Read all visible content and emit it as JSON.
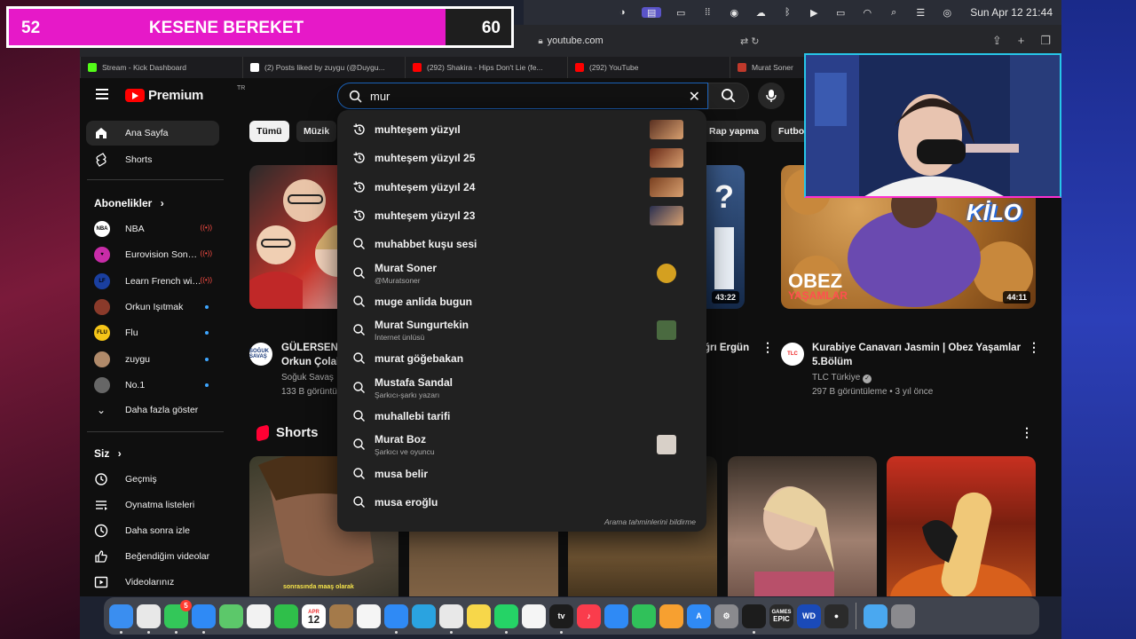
{
  "banner": {
    "left_number": "52",
    "title": "KESENE BEREKET",
    "right_number": "60",
    "progress_fraction": 0.87
  },
  "menubar": {
    "clock": "Sun Apr 12  21:44"
  },
  "browser": {
    "url": "youtube.com"
  },
  "tabs": [
    {
      "label": "Stream - Kick Dashboard",
      "color": "#53fc18"
    },
    {
      "label": "(2) Posts liked by zuygu (@Duygu...",
      "color": "#ffffff"
    },
    {
      "label": "(292) Shakira - Hips Don't Lie (fe...",
      "color": "#ff0000"
    },
    {
      "label": "(292) YouTube",
      "color": "#ff0000"
    },
    {
      "label": "Murat Soner",
      "color": "#c0392b"
    }
  ],
  "youtube": {
    "logo_text": "Premium",
    "logo_tr": "TR",
    "search_value": "mur",
    "report_text": "Arama tahminlerini bildirme"
  },
  "sidebar": {
    "home": "Ana Sayfa",
    "shorts": "Shorts",
    "subscriptions_header": "Abonelikler",
    "subscriptions": [
      {
        "label": "NBA",
        "live": true,
        "avatar_text": "NBA",
        "color": "#ffffff"
      },
      {
        "label": "Eurovision Song ...",
        "live": true,
        "avatar_text": "♥",
        "color": "#c82ca8"
      },
      {
        "label": "Learn French wit...",
        "live": true,
        "avatar_text": "LF",
        "color": "#1a3fa0"
      },
      {
        "label": "Orkun Işıtmak",
        "live": false,
        "avatar_text": "",
        "color": "#8a3a2a"
      },
      {
        "label": "Flu",
        "live": false,
        "avatar_text": "FLU",
        "color": "#f5c518"
      },
      {
        "label": "zuygu",
        "live": false,
        "avatar_text": "",
        "color": "#b08a6a"
      },
      {
        "label": "No.1",
        "live": false,
        "avatar_text": "",
        "color": "#666666"
      }
    ],
    "show_more": "Daha fazla göster",
    "you_header": "Siz",
    "you_items": [
      "Geçmiş",
      "Oynatma listeleri",
      "Daha sonra izle",
      "Beğendiğim videolar",
      "Videolarınız"
    ]
  },
  "chips": [
    "Tümü",
    "Müzik",
    "Rap yapma",
    "Futbol"
  ],
  "videos": [
    {
      "title_line1": "GÜLERSEN K",
      "title_line2": "Orkun Çolak",
      "channel": "Soğuk Savaş",
      "views": "133 B görüntü",
      "avatar_text": "SOĞUK SAVAŞ"
    },
    {
      "duration": "43:22",
      "title_line1": "ğrı Ergün"
    },
    {
      "duration": "44:11",
      "title_line1": "Kurabiye Canavarı Jasmin | Obez Yaşamlar",
      "title_line2": "5.Bölüm",
      "channel": "TLC Türkiye",
      "views": "297 B görüntüleme • 3 yıl önce",
      "avatar_text": "TLC",
      "overlay_top": "KİLO",
      "overlay_bottom_1": "OBEZ",
      "overlay_bottom_2": "YAŞAMLAR"
    }
  ],
  "shorts_section": {
    "title": "Shorts",
    "caption_1": "sonrasında maaş olarak"
  },
  "suggestions": [
    {
      "text": "muhteşem yüzyıl",
      "history": true,
      "thumb": "#5a3020"
    },
    {
      "text": "muhteşem yüzyıl 25",
      "history": true,
      "thumb": "#6a2a18"
    },
    {
      "text": "muhteşem yüzyıl 24",
      "history": true,
      "thumb": "#7a4020"
    },
    {
      "text": "muhteşem yüzyıl 23",
      "history": true,
      "thumb": "#2a3050"
    },
    {
      "text": "muhabbet kuşu sesi"
    },
    {
      "text": "Murat Soner",
      "sub": "@Muratsoner",
      "avatar": "#d4a020"
    },
    {
      "text": "muge anlida bugun"
    },
    {
      "text": "Murat Sungurtekin",
      "sub": "İnternet ünlüsü",
      "square": "#4a6a40"
    },
    {
      "text": "murat göğebakan"
    },
    {
      "text": "Mustafa Sandal",
      "sub": "Şarkıcı-şarkı yazarı"
    },
    {
      "text": "muhallebi tarifi"
    },
    {
      "text": "Murat Boz",
      "sub": "Şarkıcı ve oyuncu",
      "square": "#d8d0c8"
    },
    {
      "text": "musa belir"
    },
    {
      "text": "musa eroğlu"
    }
  ],
  "dock": [
    {
      "name": "finder-icon",
      "color": "#3a8ef0",
      "label": ""
    },
    {
      "name": "launchpad-icon",
      "color": "#e8e8e8",
      "label": ""
    },
    {
      "name": "messages-icon",
      "color": "#33c759",
      "label": "",
      "badge": "5"
    },
    {
      "name": "mail-icon",
      "color": "#2f8af5",
      "label": ""
    },
    {
      "name": "maps-icon",
      "color": "#5cc86a",
      "label": ""
    },
    {
      "name": "photos-icon",
      "color": "#f2f2f2",
      "label": ""
    },
    {
      "name": "facetime-icon",
      "color": "#2fbf4a",
      "label": ""
    },
    {
      "name": "calendar-icon",
      "color": "#ffffff",
      "label": "12",
      "sub": "APR"
    },
    {
      "name": "notes-brown-icon",
      "color": "#a47a4a",
      "label": ""
    },
    {
      "name": "reminders-icon",
      "color": "#f5f5f5",
      "label": ""
    },
    {
      "name": "safari-icon",
      "color": "#2f8af5",
      "label": ""
    },
    {
      "name": "telegram-icon",
      "color": "#2aa3e0",
      "label": ""
    },
    {
      "name": "chrome-icon",
      "color": "#e8e8e8",
      "label": ""
    },
    {
      "name": "notes-icon",
      "color": "#f7d74a",
      "label": ""
    },
    {
      "name": "whatsapp-icon",
      "color": "#25d366",
      "label": ""
    },
    {
      "name": "freeform-icon",
      "color": "#f5f5f5",
      "label": ""
    },
    {
      "name": "tv-icon",
      "color": "#1c1c1c",
      "label": "tv"
    },
    {
      "name": "music-icon",
      "color": "#fa3c4c",
      "label": "♪"
    },
    {
      "name": "keynote-icon",
      "color": "#2f8af5",
      "label": ""
    },
    {
      "name": "numbers-icon",
      "color": "#30c15a",
      "label": ""
    },
    {
      "name": "pages-icon",
      "color": "#f7a030",
      "label": ""
    },
    {
      "name": "app-store-icon",
      "color": "#2f8af5",
      "label": "A"
    },
    {
      "name": "settings-icon",
      "color": "#8a8a8e",
      "label": "⚙"
    },
    {
      "name": "xcode-icon",
      "color": "#1c1c1c",
      "label": ""
    },
    {
      "name": "epic-games-icon",
      "color": "#2a2a2a",
      "label": "EPIC",
      "sub": "GAMES"
    },
    {
      "name": "wd-icon",
      "color": "#1a4ab8",
      "label": "WD"
    },
    {
      "name": "obs-icon",
      "color": "#2b2b2b",
      "label": "●"
    },
    {
      "name": "folder-icon",
      "color": "#4aa8f0",
      "label": ""
    },
    {
      "name": "trash-icon",
      "color": "#8a8a8e",
      "label": ""
    }
  ]
}
